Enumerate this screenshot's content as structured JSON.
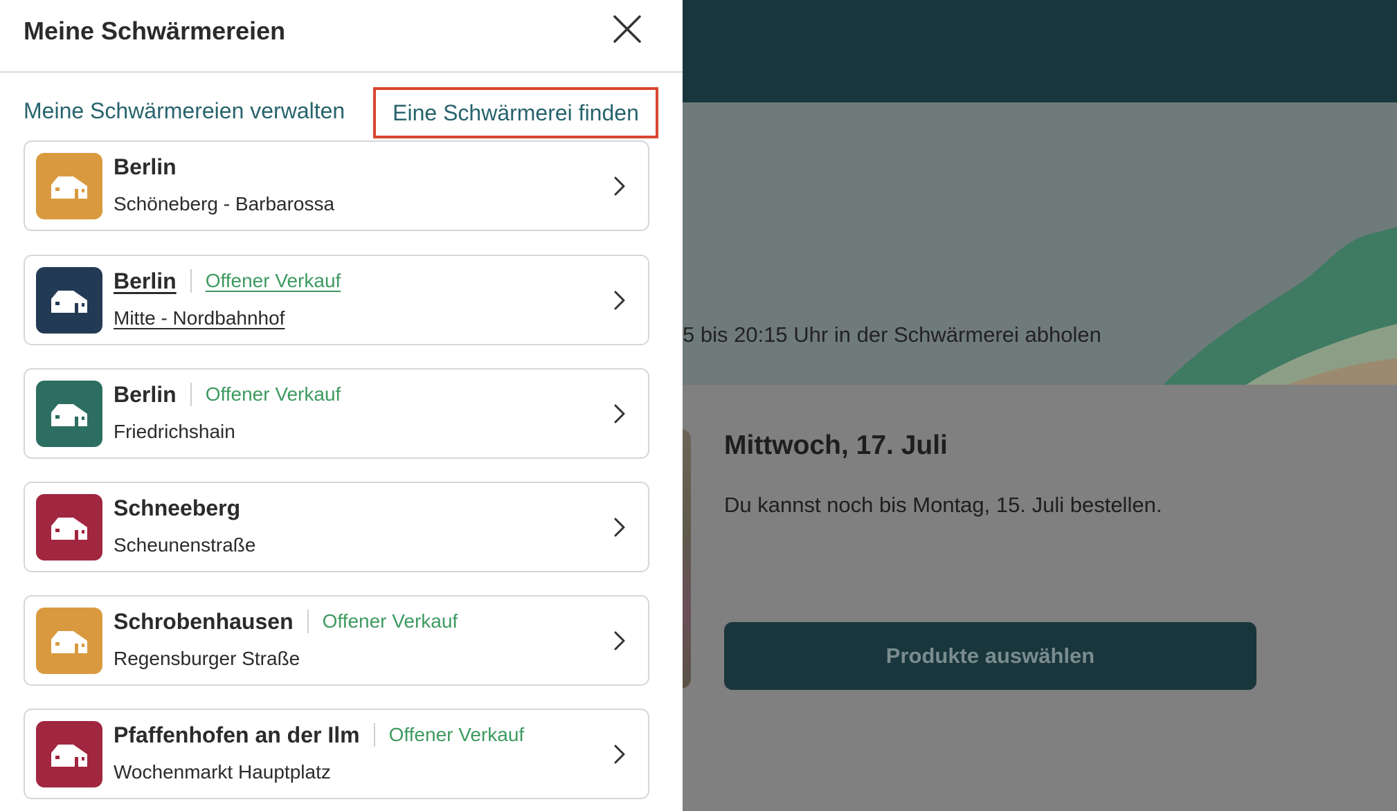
{
  "drawer": {
    "title": "Meine Schwärmereien",
    "links": {
      "manage": "Meine Schwärmereien verwalten",
      "find": "Eine Schwärmerei finden"
    },
    "items": [
      {
        "title": "Berlin",
        "subtitle": "Schöneberg - Barbarossa",
        "tag": "",
        "color": "#d99a3f"
      },
      {
        "title": "Berlin",
        "subtitle": "Mitte - Nordbahnhof",
        "tag": "Offener Verkauf",
        "color": "#233a54"
      },
      {
        "title": "Berlin",
        "subtitle": "Friedrichshain",
        "tag": "Offener Verkauf",
        "color": "#2d6e62"
      },
      {
        "title": "Schneeberg",
        "subtitle": "Scheunenstraße",
        "tag": "",
        "color": "#a1263f"
      },
      {
        "title": "Schrobenhausen",
        "subtitle": "Regensburger Straße",
        "tag": "Offener Verkauf",
        "color": "#d99a3f"
      },
      {
        "title": "Pfaffenhofen an der Ilm",
        "subtitle": "Wochenmarkt Hauptplatz",
        "tag": "Offener Verkauf",
        "color": "#a1263f"
      }
    ]
  },
  "background": {
    "pickup_text": "5 bis 20:15 Uhr in der Schwärmerei abholen",
    "date": "Mittwoch, 17. Juli",
    "order_info": "Du kannst noch bis Montag, 15. Juli bestellen.",
    "button_label": "Produkte auswählen"
  },
  "colors": {
    "accent_link": "#27636c",
    "tag_green": "#3d9a60",
    "highlight_border": "#d9462f",
    "topbar": "#19363d"
  }
}
